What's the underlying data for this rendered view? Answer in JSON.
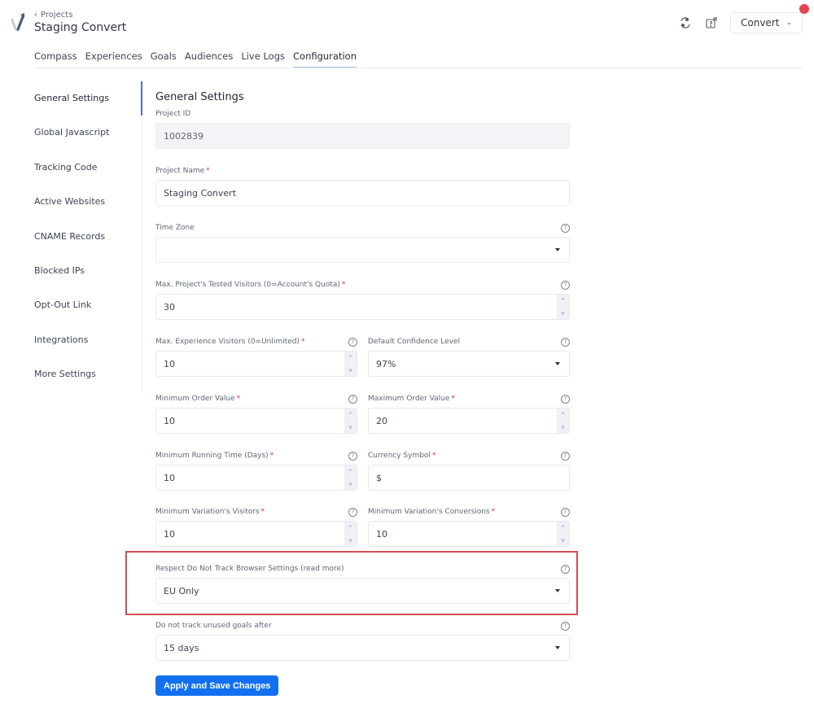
{
  "header": {
    "back_label": "Projects",
    "project_title": "Staging Convert",
    "account_button": "Convert"
  },
  "tabs": [
    {
      "label": "Compass",
      "active": false
    },
    {
      "label": "Experiences",
      "active": false
    },
    {
      "label": "Goals",
      "active": false
    },
    {
      "label": "Audiences",
      "active": false
    },
    {
      "label": "Live Logs",
      "active": false
    },
    {
      "label": "Configuration",
      "active": true
    }
  ],
  "sidebar": {
    "items": [
      {
        "label": "General Settings",
        "active": true
      },
      {
        "label": "Global Javascript"
      },
      {
        "label": "Tracking Code"
      },
      {
        "label": "Active Websites"
      },
      {
        "label": "CNAME Records"
      },
      {
        "label": "Blocked IPs"
      },
      {
        "label": "Opt-Out Link"
      },
      {
        "label": "Integrations"
      },
      {
        "label": "More Settings"
      }
    ]
  },
  "form": {
    "title": "General Settings",
    "project_id": {
      "label": "Project ID",
      "value": "1002839"
    },
    "project_name": {
      "label": "Project Name",
      "value": "Staging Convert",
      "required": true
    },
    "time_zone": {
      "label": "Time Zone",
      "value": ""
    },
    "max_project_visitors": {
      "label": "Max. Project's Tested Visitors (0=Account's Quota)",
      "value": "30",
      "required": true
    },
    "max_experience_visitors": {
      "label": "Max. Experience Visitors (0=Unlimited)",
      "value": "10",
      "required": true
    },
    "confidence_level": {
      "label": "Default Confidence Level",
      "value": "97%"
    },
    "min_order_value": {
      "label": "Minimum Order Value",
      "value": "10",
      "required": true
    },
    "max_order_value": {
      "label": "Maximum Order Value",
      "value": "20",
      "required": true
    },
    "min_running_time": {
      "label": "Minimum Running Time (Days)",
      "value": "10",
      "required": true
    },
    "currency_symbol": {
      "label": "Currency Symbol",
      "value": "$",
      "required": true
    },
    "min_variation_visitors": {
      "label": "Minimum Variation's Visitors",
      "value": "10",
      "required": true
    },
    "min_variation_conversions": {
      "label": "Minimum Variation's Conversions",
      "value": "10",
      "required": true
    },
    "do_not_track": {
      "label": "Respect Do Not Track Browser Settings (read more)",
      "value": "EU Only"
    },
    "unused_goals": {
      "label": "Do not track unused goals after",
      "value": "15 days"
    },
    "required_mark": "*",
    "help_glyph": "?",
    "spin_up": "^",
    "spin_down": "v"
  },
  "save_button": "Apply and Save Changes",
  "colors": {
    "primary": "#1270f0",
    "highlight": "#d04f56",
    "notification": "#e8434f"
  }
}
